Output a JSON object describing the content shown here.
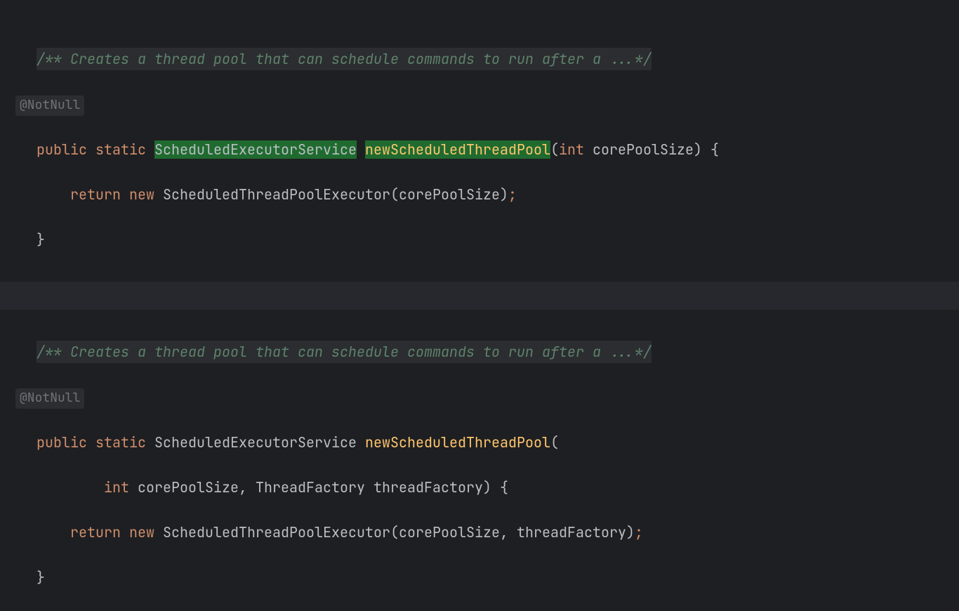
{
  "colors": {
    "bg": "#1e1f22",
    "fold_bg": "#2b2d30",
    "comment": "#5f826b",
    "keyword": "#cf8e6d",
    "method": "#ffc66d",
    "highlight": "#1f6b2f",
    "text": "#bcbec4"
  },
  "block1": {
    "javadoc": "/** Creates a thread pool that can schedule commands to run after a ...*/",
    "annotation": "@NotNull",
    "kw_public": "public",
    "kw_static": "static",
    "return_type": "ScheduledExecutorService",
    "method_name": "newScheduledThreadPool",
    "param_kw": "int",
    "param_name": "corePoolSize",
    "open_brace": "{",
    "body_kw_return": "return",
    "body_kw_new": "new",
    "body_ctor": "ScheduledThreadPoolExecutor",
    "body_arg": "corePoolSize",
    "body_semi": ";",
    "close_brace": "}"
  },
  "block2": {
    "javadoc": "/** Creates a thread pool that can schedule commands to run after a ...*/",
    "annotation": "@NotNull",
    "kw_public": "public",
    "kw_static": "static",
    "return_type": "ScheduledExecutorService",
    "method_name": "newScheduledThreadPool",
    "param1_kw": "int",
    "param1_name": "corePoolSize",
    "param2_type": "ThreadFactory",
    "param2_name": "threadFactory",
    "open_brace": "{",
    "body_kw_return": "return",
    "body_kw_new": "new",
    "body_ctor": "ScheduledThreadPoolExecutor",
    "body_arg1": "corePoolSize",
    "body_arg2": "threadFactory",
    "body_semi": ";",
    "close_brace": "}"
  }
}
